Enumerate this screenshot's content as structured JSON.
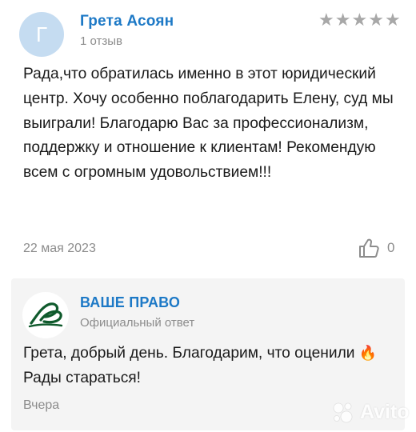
{
  "review": {
    "author": {
      "initial": "Г",
      "name": "Грета Асоян",
      "review_count": "1 отзыв"
    },
    "rating": 5,
    "text": "Рада,что обратилась именно в этот юридический центр. Хочу особенно поблагодарить Елену, суд мы выиграли! Благодарю Вас за профессионализм, поддержку и отношение к клиентам! Рекомендую всем с огромным удовольствием!!!",
    "date": "22 мая 2023",
    "likes": "0"
  },
  "reply": {
    "company_name": "ВАШЕ ПРАВО",
    "label": "Официальный ответ",
    "text_before": "Грета, добрый день. Благодарим, что оценили",
    "emoji": "🔥",
    "text_after": "Рады стараться!",
    "date": "Вчера"
  },
  "watermark": {
    "text": "Avito",
    "icon": "avito-logo-icon"
  },
  "colors": {
    "accent": "#1d79c6",
    "muted": "#8c8c8c",
    "star": "#a8a8a8",
    "avatar_bg": "#c5dcf1",
    "reply_bg": "#f4f4f4",
    "logo_green": "#0f5a2c"
  }
}
